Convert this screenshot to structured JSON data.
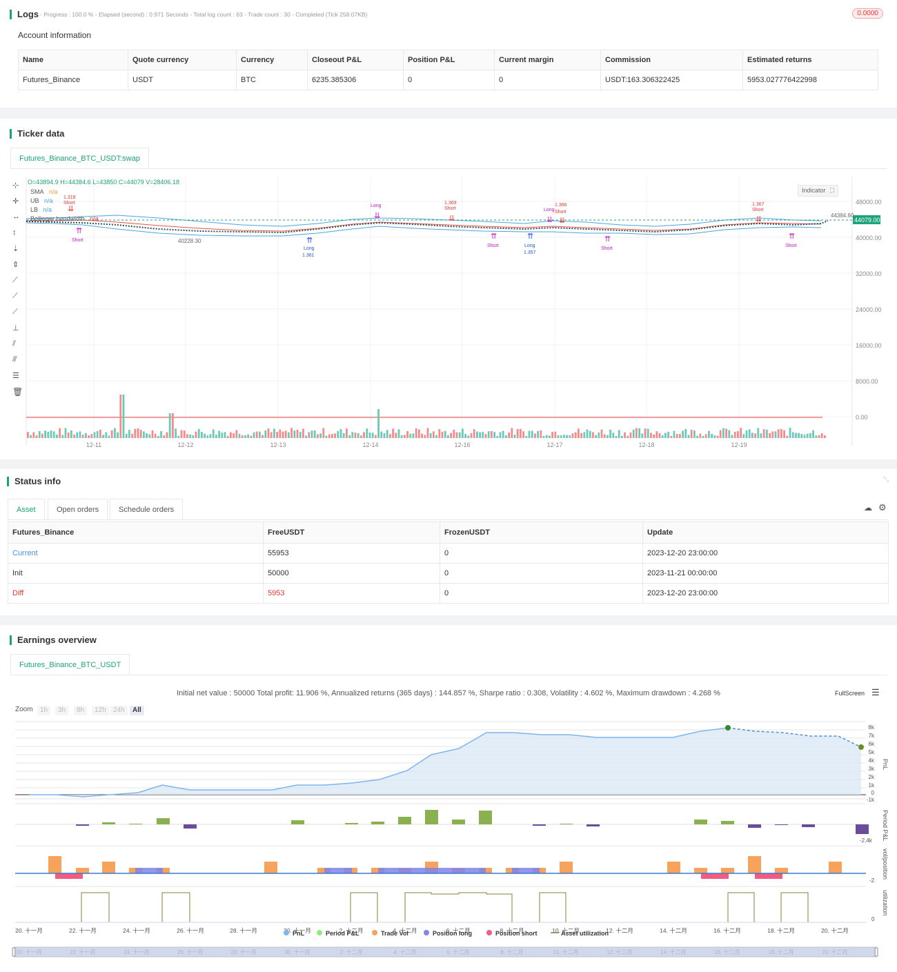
{
  "logs": {
    "title": "Logs",
    "summary": "- Progress : 100.0 % - Elapsed (second) : 0.971  Seconds - Total log count : 63 - Trade count : 30 - Completed (Tick 258.07KB)",
    "badge": "0.0000",
    "account_title": "Account information",
    "columns": [
      "Name",
      "Quote currency",
      "Currency",
      "Closeout P&L",
      "Position P&L",
      "Current margin",
      "Commission",
      "Estimated returns"
    ],
    "row": [
      "Futures_Binance",
      "USDT",
      "BTC",
      "6235.385306",
      "0",
      "0",
      "USDT:163.306322425",
      "5953.027776422998"
    ]
  },
  "ticker": {
    "title": "Ticker data",
    "tab": "Futures_Binance_BTC_USDT:swap",
    "ohlc": "O=43894.9 H=44384.6 L=43850 C=44079 V=28406.18",
    "legend": [
      {
        "name": "SMA",
        "value": "n/a"
      },
      {
        "name": "UB",
        "value": "n/a"
      },
      {
        "name": "LB",
        "value": "n/a"
      },
      {
        "name": "Bollinger bandwidth",
        "value": "n/a"
      }
    ],
    "indicator_button": "Indicator",
    "price_label": "44079.00",
    "high_label": "44384.60",
    "low_label": "40228.30",
    "y_ticks": [
      "48000.00",
      "40000.00",
      "32000.00",
      "24000.00",
      "16000.00",
      "8000.00",
      "0.00"
    ],
    "x_ticks": [
      "12-11",
      "12-12",
      "12-13",
      "12-14",
      "12-16",
      "12-17",
      "12-18",
      "12-19"
    ],
    "annotations": {
      "short_labels": [
        "1.318",
        "1.369",
        "1.366",
        "1.367"
      ],
      "long_labels": [
        "1.361",
        "1.357"
      ],
      "long": "Long",
      "short": "Short"
    }
  },
  "status": {
    "title": "Status info",
    "tabs": [
      "Asset",
      "Open orders",
      "Schedule orders"
    ],
    "columns": [
      "Futures_Binance",
      "FreeUSDT",
      "FrozenUSDT",
      "Update"
    ],
    "rows": [
      [
        "Current",
        "55953",
        "0",
        "2023-12-20 23:00:00"
      ],
      [
        "Init",
        "50000",
        "0",
        "2023-11-21 00:00:00"
      ],
      [
        "Diff",
        "5953",
        "0",
        "2023-12-20 23:00:00"
      ]
    ]
  },
  "earnings": {
    "title": "Earnings overview",
    "tab": "Futures_Binance_BTC_USDT",
    "summary": "Initial net value : 50000  Total profit: 11.906 %, Annualized returns (365 days) : 144.857 %, Sharpe ratio : 0.308, Volatility : 4.602 %, Maximum drawdown : 4.268 %",
    "fullscreen": "FullScreen",
    "zoom_label": "Zoom",
    "zoom_options": [
      "1h",
      "3h",
      "8h",
      "12h",
      "24h",
      "All"
    ],
    "pnl_ticks": [
      "8k",
      "7k",
      "6k",
      "5k",
      "4k",
      "3k",
      "2k",
      "1k",
      "0",
      "-1k"
    ],
    "axis_titles": [
      "PnL",
      "Period P&L",
      "vol/position",
      "utilization"
    ],
    "period_low": "-2.4k",
    "vol_low": "-2",
    "util_zero": "0",
    "x_ticks": [
      "20. 十一月",
      "22. 十一月",
      "24. 十一月",
      "26. 十一月",
      "28. 十一月",
      "30. 十一月",
      "2. 十二月",
      "4. 十二月",
      "6. 十二月",
      "8. 十二月",
      "10. 十二月",
      "12. 十二月",
      "14. 十二月",
      "16. 十二月",
      "18. 十二月",
      "20. 十二月"
    ],
    "legend": [
      {
        "name": "PnL",
        "color": "#7cb5ec"
      },
      {
        "name": "Period P&L",
        "color": "#90ed7d"
      },
      {
        "name": "Trade Vol",
        "color": "#f7a35c"
      },
      {
        "name": "Position long",
        "color": "#8085e9"
      },
      {
        "name": "Position short",
        "color": "#f15c80"
      },
      {
        "name": "Asset utilization",
        "color": "#8d7b3a"
      }
    ]
  }
}
